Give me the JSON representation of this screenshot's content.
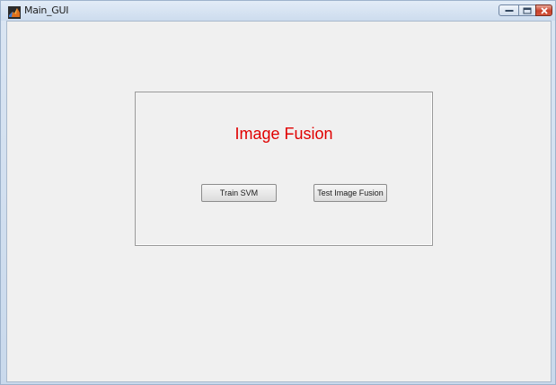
{
  "window": {
    "title": "Main_GUI",
    "icon": "matlab-icon"
  },
  "caption_buttons": {
    "minimize_icon": "minimize-icon",
    "maximize_icon": "maximize-icon",
    "close_icon": "close-icon"
  },
  "panel": {
    "heading": "Image Fusion",
    "heading_color": "#e00000"
  },
  "buttons": {
    "train_label": "Train SVM",
    "test_label": "Test Image Fusion"
  }
}
